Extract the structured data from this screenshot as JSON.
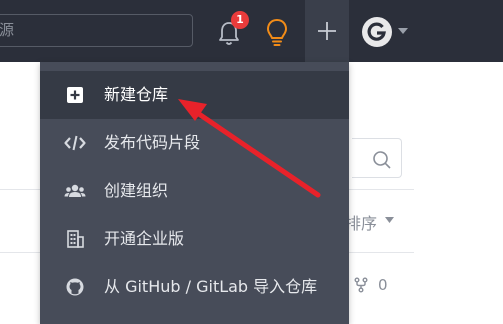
{
  "header": {
    "search_partial_text": "源",
    "notification_count": "1"
  },
  "menu": {
    "items": [
      {
        "label": "新建仓库",
        "icon": "plus-square-icon"
      },
      {
        "label": "发布代码片段",
        "icon": "code-icon"
      },
      {
        "label": "创建组织",
        "icon": "users-icon"
      },
      {
        "label": "开通企业版",
        "icon": "building-icon"
      },
      {
        "label": "从 GitHub / GitLab 导入仓库",
        "icon": "github-icon"
      }
    ]
  },
  "background": {
    "sort_label": "排序",
    "fork_count": "0"
  },
  "colors": {
    "topbar": "#2b2f3a",
    "dropdown": "#474c59",
    "active_item": "#353a45",
    "arrow": "#e8222a",
    "bulb": "#f28c18",
    "badge": "#e93b3b"
  }
}
